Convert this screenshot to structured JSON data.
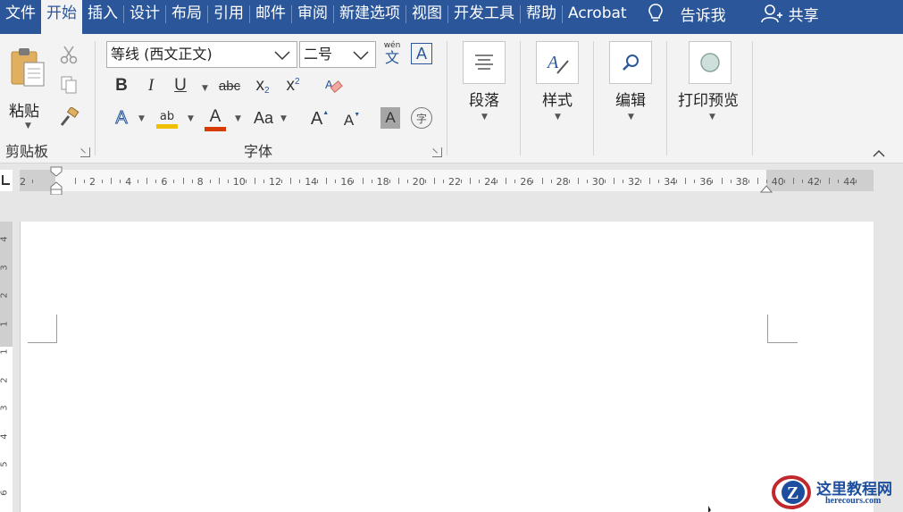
{
  "tabs": [
    {
      "label": "文件",
      "active": false
    },
    {
      "label": "开始",
      "active": true
    },
    {
      "label": "插入",
      "active": false
    },
    {
      "label": "设计",
      "active": false
    },
    {
      "label": "布局",
      "active": false
    },
    {
      "label": "引用",
      "active": false
    },
    {
      "label": "邮件",
      "active": false
    },
    {
      "label": "审阅",
      "active": false
    },
    {
      "label": "新建选项",
      "active": false
    },
    {
      "label": "视图",
      "active": false
    },
    {
      "label": "开发工具",
      "active": false
    },
    {
      "label": "帮助",
      "active": false
    },
    {
      "label": "Acrobat",
      "active": false
    }
  ],
  "tell_me": {
    "label": "告诉我",
    "icon": "lightbulb-icon"
  },
  "share": {
    "label": "共享",
    "icon": "person-add-icon"
  },
  "clipboard": {
    "paste_label": "粘贴",
    "group_label": "剪贴板"
  },
  "font": {
    "font_name": "等线 (西文正文)",
    "font_size": "二号",
    "phonetic_top": "wén",
    "phonetic_bottom": "文",
    "border_char": "A",
    "bold": "B",
    "italic": "I",
    "underline": "U",
    "strike": "abc",
    "subscript": "x",
    "subscript_small": "2",
    "superscript": "x",
    "superscript_small": "2",
    "text_effect": "A",
    "highlight": "ab",
    "font_color": "A",
    "change_case": "Aa",
    "grow": "A",
    "shrink": "A",
    "shade": "A",
    "enclose": "字",
    "group_label": "字体"
  },
  "paragraph": {
    "label": "段落"
  },
  "styles": {
    "label": "样式"
  },
  "editing": {
    "label": "编辑"
  },
  "print_preview": {
    "label": "打印预览"
  },
  "ruler": {
    "h_labels": [
      "2",
      "2",
      "4",
      "6",
      "8",
      "10",
      "12",
      "14",
      "16",
      "18",
      "20",
      "22",
      "24",
      "26",
      "28",
      "30",
      "32",
      "34",
      "36",
      "38",
      "40",
      "42",
      "44"
    ],
    "v_labels": [
      "4",
      "3",
      "2",
      "1",
      "1",
      "2",
      "3",
      "4",
      "5",
      "6"
    ]
  },
  "watermark": {
    "title": "这里教程网",
    "url": "herecours.com",
    "letter": "Z"
  },
  "colors": {
    "accent": "#2b579a",
    "highlight": "#f0c000",
    "font_color": "#d83b01"
  }
}
